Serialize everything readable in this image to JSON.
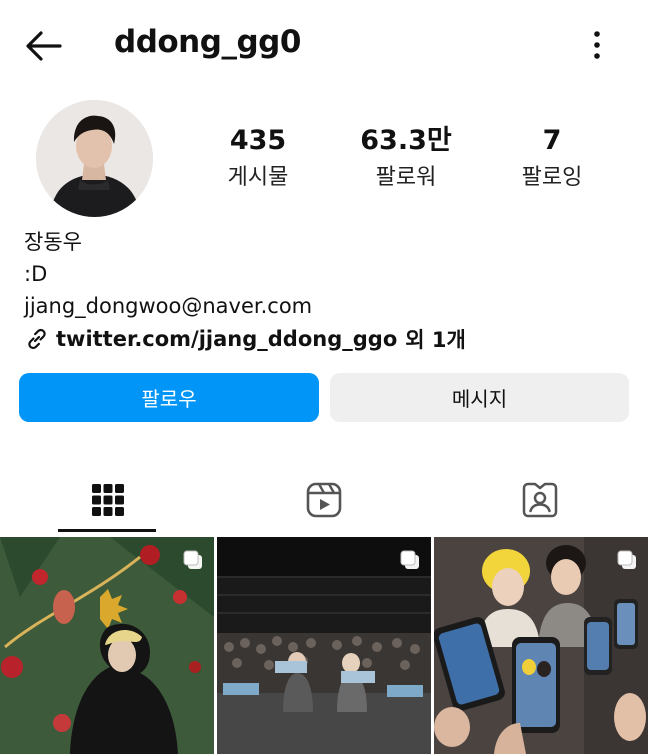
{
  "header": {
    "username": "ddong_gg0",
    "back_icon": "arrow-left-icon",
    "more_icon": "more-vertical-icon"
  },
  "profile": {
    "stats": [
      {
        "value": "435",
        "label": "게시물"
      },
      {
        "value": "63.3만",
        "label": "팔로워"
      },
      {
        "value": "7",
        "label": "팔로잉"
      }
    ],
    "bio": {
      "name": "장동우",
      "line": ":D",
      "email": "jjang_dongwoo@naver.com",
      "link": "twitter.com/jjang_ddong_ggo",
      "link_more": "외 1개"
    }
  },
  "actions": {
    "follow_label": "팔로우",
    "message_label": "메시지"
  },
  "tabs": [
    {
      "icon": "grid-icon",
      "active": true
    },
    {
      "icon": "reels-icon",
      "active": false
    },
    {
      "icon": "tagged-icon",
      "active": false
    }
  ],
  "colors": {
    "accent": "#0095f6",
    "secondary_button": "#efefef",
    "text": "#111111"
  }
}
